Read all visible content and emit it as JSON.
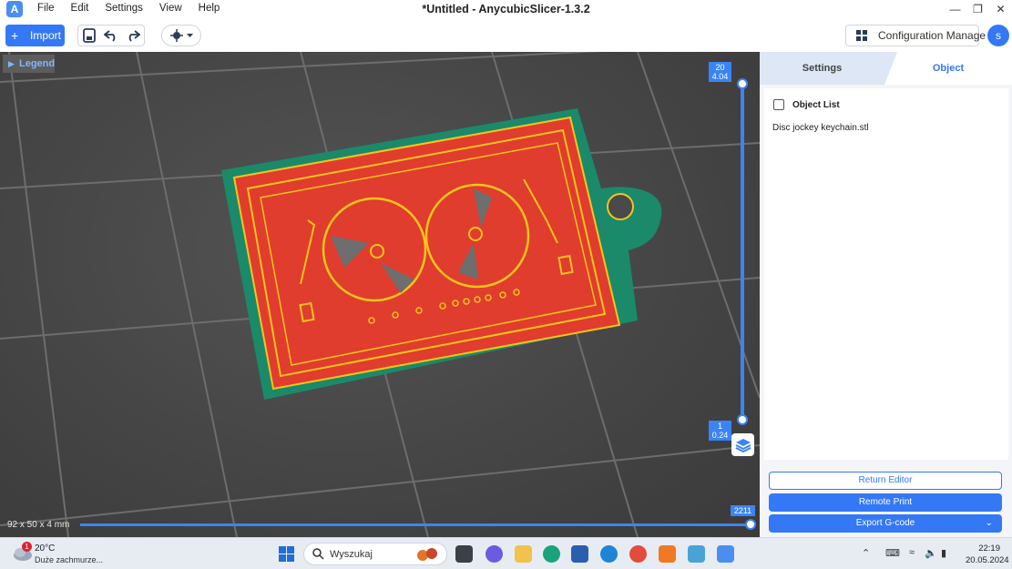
{
  "titlebar": {
    "logo": "A",
    "menu": [
      "File",
      "Edit",
      "Settings",
      "View",
      "Help"
    ],
    "title": "*Untitled - AnycubicSlicer-1.3.2",
    "minimize": "—",
    "restore": "❐",
    "close": "✕"
  },
  "toolbar": {
    "import_plus": "+",
    "import_label": "Import",
    "config_label": "Configuration Manage",
    "avatar": "s"
  },
  "viewport": {
    "legend_label": "Legend",
    "dimensions": "92 x 50 x 4 mm",
    "top_layer": "20",
    "top_height": "4.04",
    "bottom_layer": "1",
    "bottom_height": "0.24",
    "move_index": "2211",
    "colors": {
      "model_red": "#e03d2e",
      "model_outline": "#f5c518",
      "brim_green": "#1a8a6a"
    }
  },
  "panel": {
    "tab_settings": "Settings",
    "tab_object": "Object",
    "object_list_title": "Object List",
    "objects": [
      "Disc jockey keychain.stl"
    ],
    "return_editor": "Return Editor",
    "remote_print": "Remote Print",
    "export_gcode": "Export G-code"
  },
  "taskbar": {
    "weather_badge": "1",
    "weather_temp": "20°C",
    "weather_desc": "Duże zachmurze...",
    "search_placeholder": "Wyszukaj",
    "time": "22:19",
    "date": "20.05.2024"
  }
}
